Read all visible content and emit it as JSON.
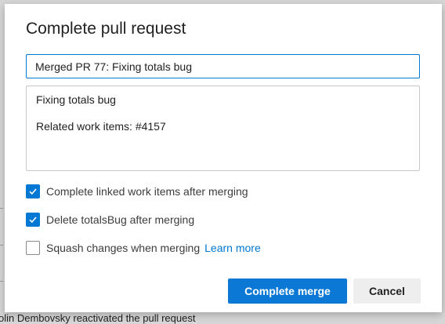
{
  "background": {
    "footer_text": "olin Dembovsky reactivated the pull request"
  },
  "dialog": {
    "title": "Complete pull request",
    "merge_title_value": "Merged PR 77: Fixing totals bug",
    "description_lines": [
      "Fixing totals bug",
      "",
      "Related work items: #4157"
    ],
    "options": [
      {
        "label": "Complete linked work items after merging",
        "checked": true
      },
      {
        "label": "Delete totalsBug after merging",
        "checked": true
      },
      {
        "label": "Squash changes when merging",
        "checked": false,
        "link": "Learn more"
      }
    ],
    "primary_button": "Complete merge",
    "secondary_button": "Cancel"
  },
  "colors": {
    "accent": "#0078d4",
    "primary_button": "#0a78d4",
    "secondary_button": "#eeeeee",
    "overlay": "#d7d7d7"
  }
}
